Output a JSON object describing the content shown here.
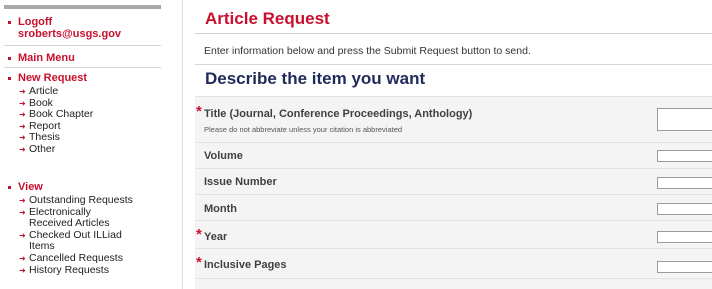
{
  "sidebar": {
    "logoff_label": "Logoff",
    "user_email": "sroberts@usgs.gov",
    "main_menu_label": "Main Menu",
    "new_request": {
      "label": "New Request",
      "items": [
        "Article",
        "Book",
        "Book Chapter",
        "Report",
        "Thesis",
        "Other"
      ]
    },
    "view": {
      "label": "View",
      "items": [
        "Outstanding Requests",
        "Electronically",
        "Received Articles",
        "Checked Out ILLiad",
        "Items",
        "Cancelled Requests",
        "History Requests"
      ]
    }
  },
  "main": {
    "page_title": "Article Request",
    "instructions": "Enter information below and press the Submit Request button to send.",
    "section_title": "Describe the item you want",
    "required_marker": "*",
    "fields": {
      "title": {
        "label": "Title (Journal, Conference Proceedings, Anthology)",
        "hint": "Please do not abbreviate unless your citation is abbreviated",
        "value": ""
      },
      "volume": {
        "label": "Volume",
        "value": ""
      },
      "issue": {
        "label": "Issue Number",
        "value": ""
      },
      "month": {
        "label": "Month",
        "value": ""
      },
      "year": {
        "label": "Year",
        "value": ""
      },
      "pages": {
        "label": "Inclusive Pages",
        "value": ""
      }
    }
  },
  "colors": {
    "accent_red": "#c8102e",
    "heading_navy": "#1f2a5a",
    "form_background": "#f4f4f4"
  }
}
